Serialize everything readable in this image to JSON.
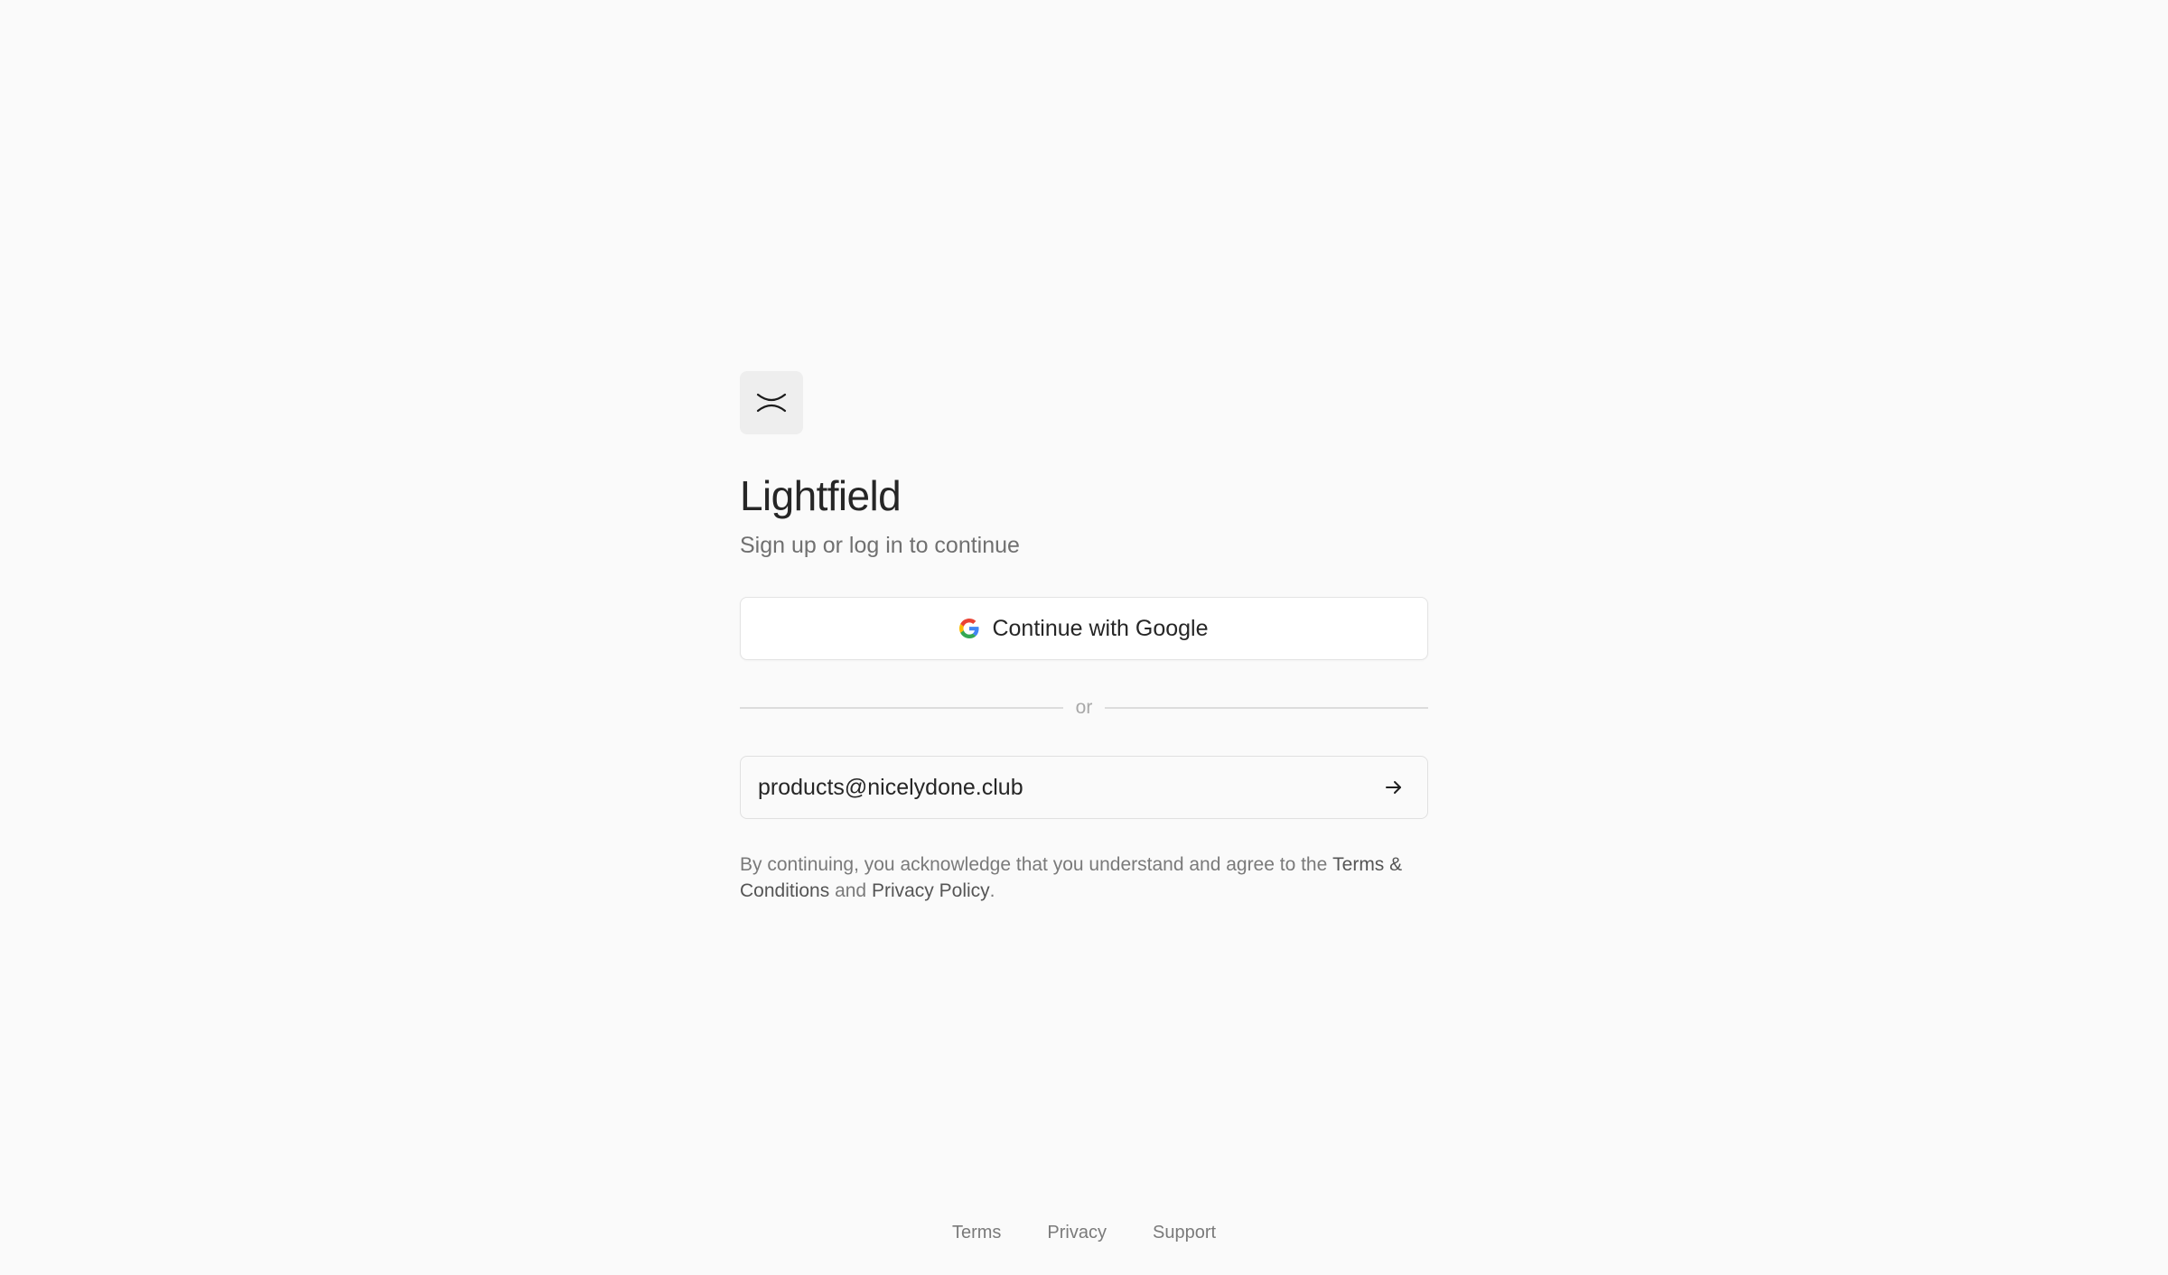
{
  "app": {
    "title": "Lightfield",
    "subtitle": "Sign up or log in to continue",
    "logo_icon": "lightfield-logo-icon"
  },
  "google_button": {
    "label": "Continue with Google",
    "icon": "google-icon"
  },
  "divider": {
    "text": "or"
  },
  "email": {
    "value": "products@nicelydone.club",
    "submit_icon": "arrow-right-icon"
  },
  "legal": {
    "prefix": "By continuing, you acknowledge that you understand and agree to the ",
    "terms_link": "Terms & Conditions",
    "middle": " and ",
    "privacy_link": "Privacy Policy",
    "suffix": "."
  },
  "footer": {
    "terms": "Terms",
    "privacy": "Privacy",
    "support": "Support"
  },
  "colors": {
    "background": "#fafafa",
    "text_primary": "#262626",
    "text_secondary": "#707070",
    "border": "#e0e0e0",
    "logo_background": "#eeeeee"
  }
}
